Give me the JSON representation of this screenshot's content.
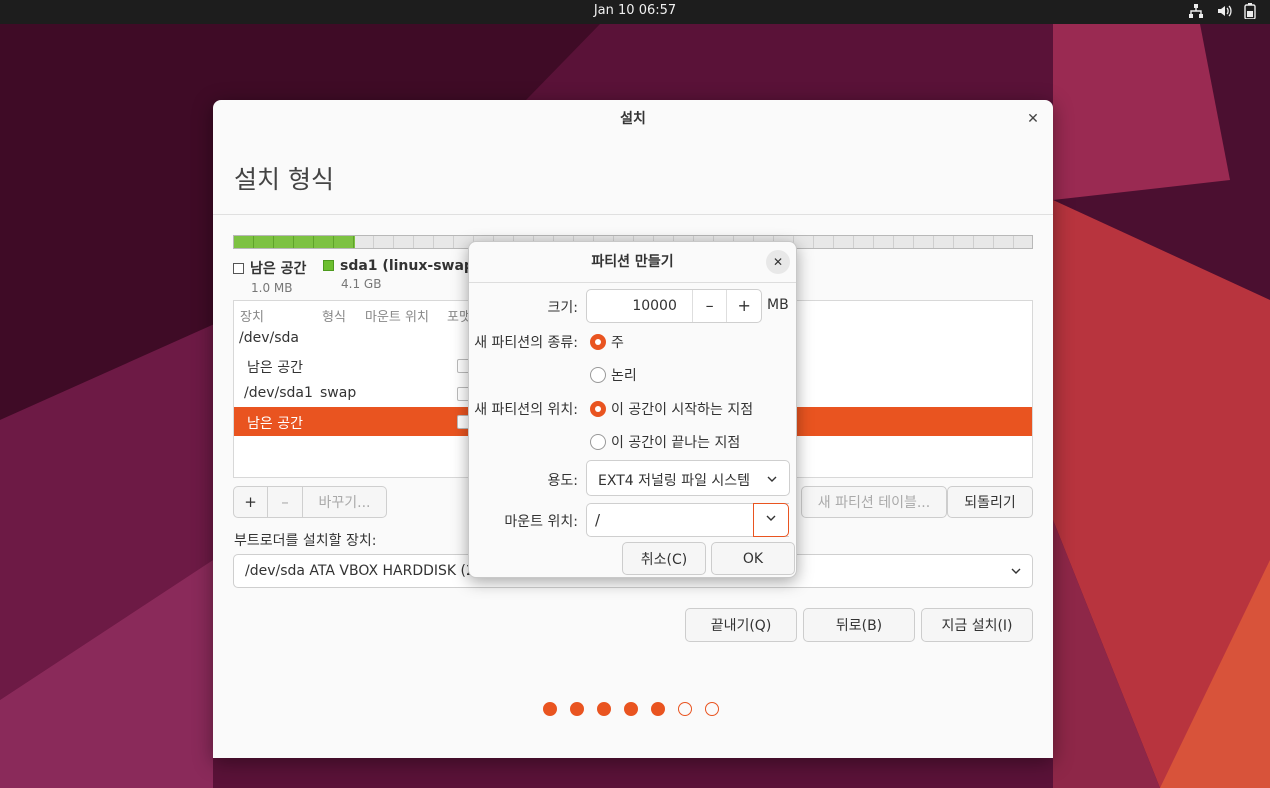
{
  "topbar": {
    "clock": "Jan 10  06:57"
  },
  "window": {
    "title": "설치",
    "heading": "설치 형식",
    "legend": [
      {
        "name": "남은 공간",
        "size": "1.0 MB",
        "color": "#ffffff"
      },
      {
        "name": "sda1 (linux-swap)",
        "size": "4.1 GB",
        "color": "#6cbf2f"
      }
    ],
    "table": {
      "headers": [
        "장치",
        "형식",
        "마운트 위치",
        "포맷"
      ],
      "rows": [
        {
          "device": "/dev/sda",
          "type": ""
        },
        {
          "device": "남은 공간",
          "type": ""
        },
        {
          "device": "/dev/sda1",
          "type": "swap"
        },
        {
          "device": "남은 공간",
          "type": ""
        }
      ]
    },
    "table_buttons": {
      "add": "+",
      "remove": "–",
      "change": "바꾸기..."
    },
    "new_table_button": "새 파티션 테이블...",
    "revert_button": "되돌리기",
    "bootloader_label": "부트로더를 설치할 장치:",
    "bootloader_device": "/dev/sda ATA VBOX HARDDISK (2",
    "quit_button": "끝내기(Q)",
    "back_button": "뒤로(B)",
    "install_button": "지금 설치(I)",
    "progress": {
      "total_steps": 7,
      "completed_steps": 5
    }
  },
  "dialog": {
    "title": "파티션 만들기",
    "size_label": "크기:",
    "size_value": "10000",
    "size_minus": "–",
    "size_plus": "+",
    "size_unit": "MB",
    "type_label": "새 파티션의 종류:",
    "type_primary": "주",
    "type_logical": "논리",
    "location_label": "새 파티션의 위치:",
    "location_start": "이 공간이 시작하는 지점",
    "location_end": "이 공간이 끝나는 지점",
    "use_label": "용도:",
    "use_value": "EXT4 저널링 파일 시스템",
    "mount_label": "마운트 위치:",
    "mount_value": "/",
    "cancel_button": "취소(C)",
    "ok_button": "OK"
  },
  "colors": {
    "accent": "#e95420",
    "swap": "#6cbf2f"
  }
}
